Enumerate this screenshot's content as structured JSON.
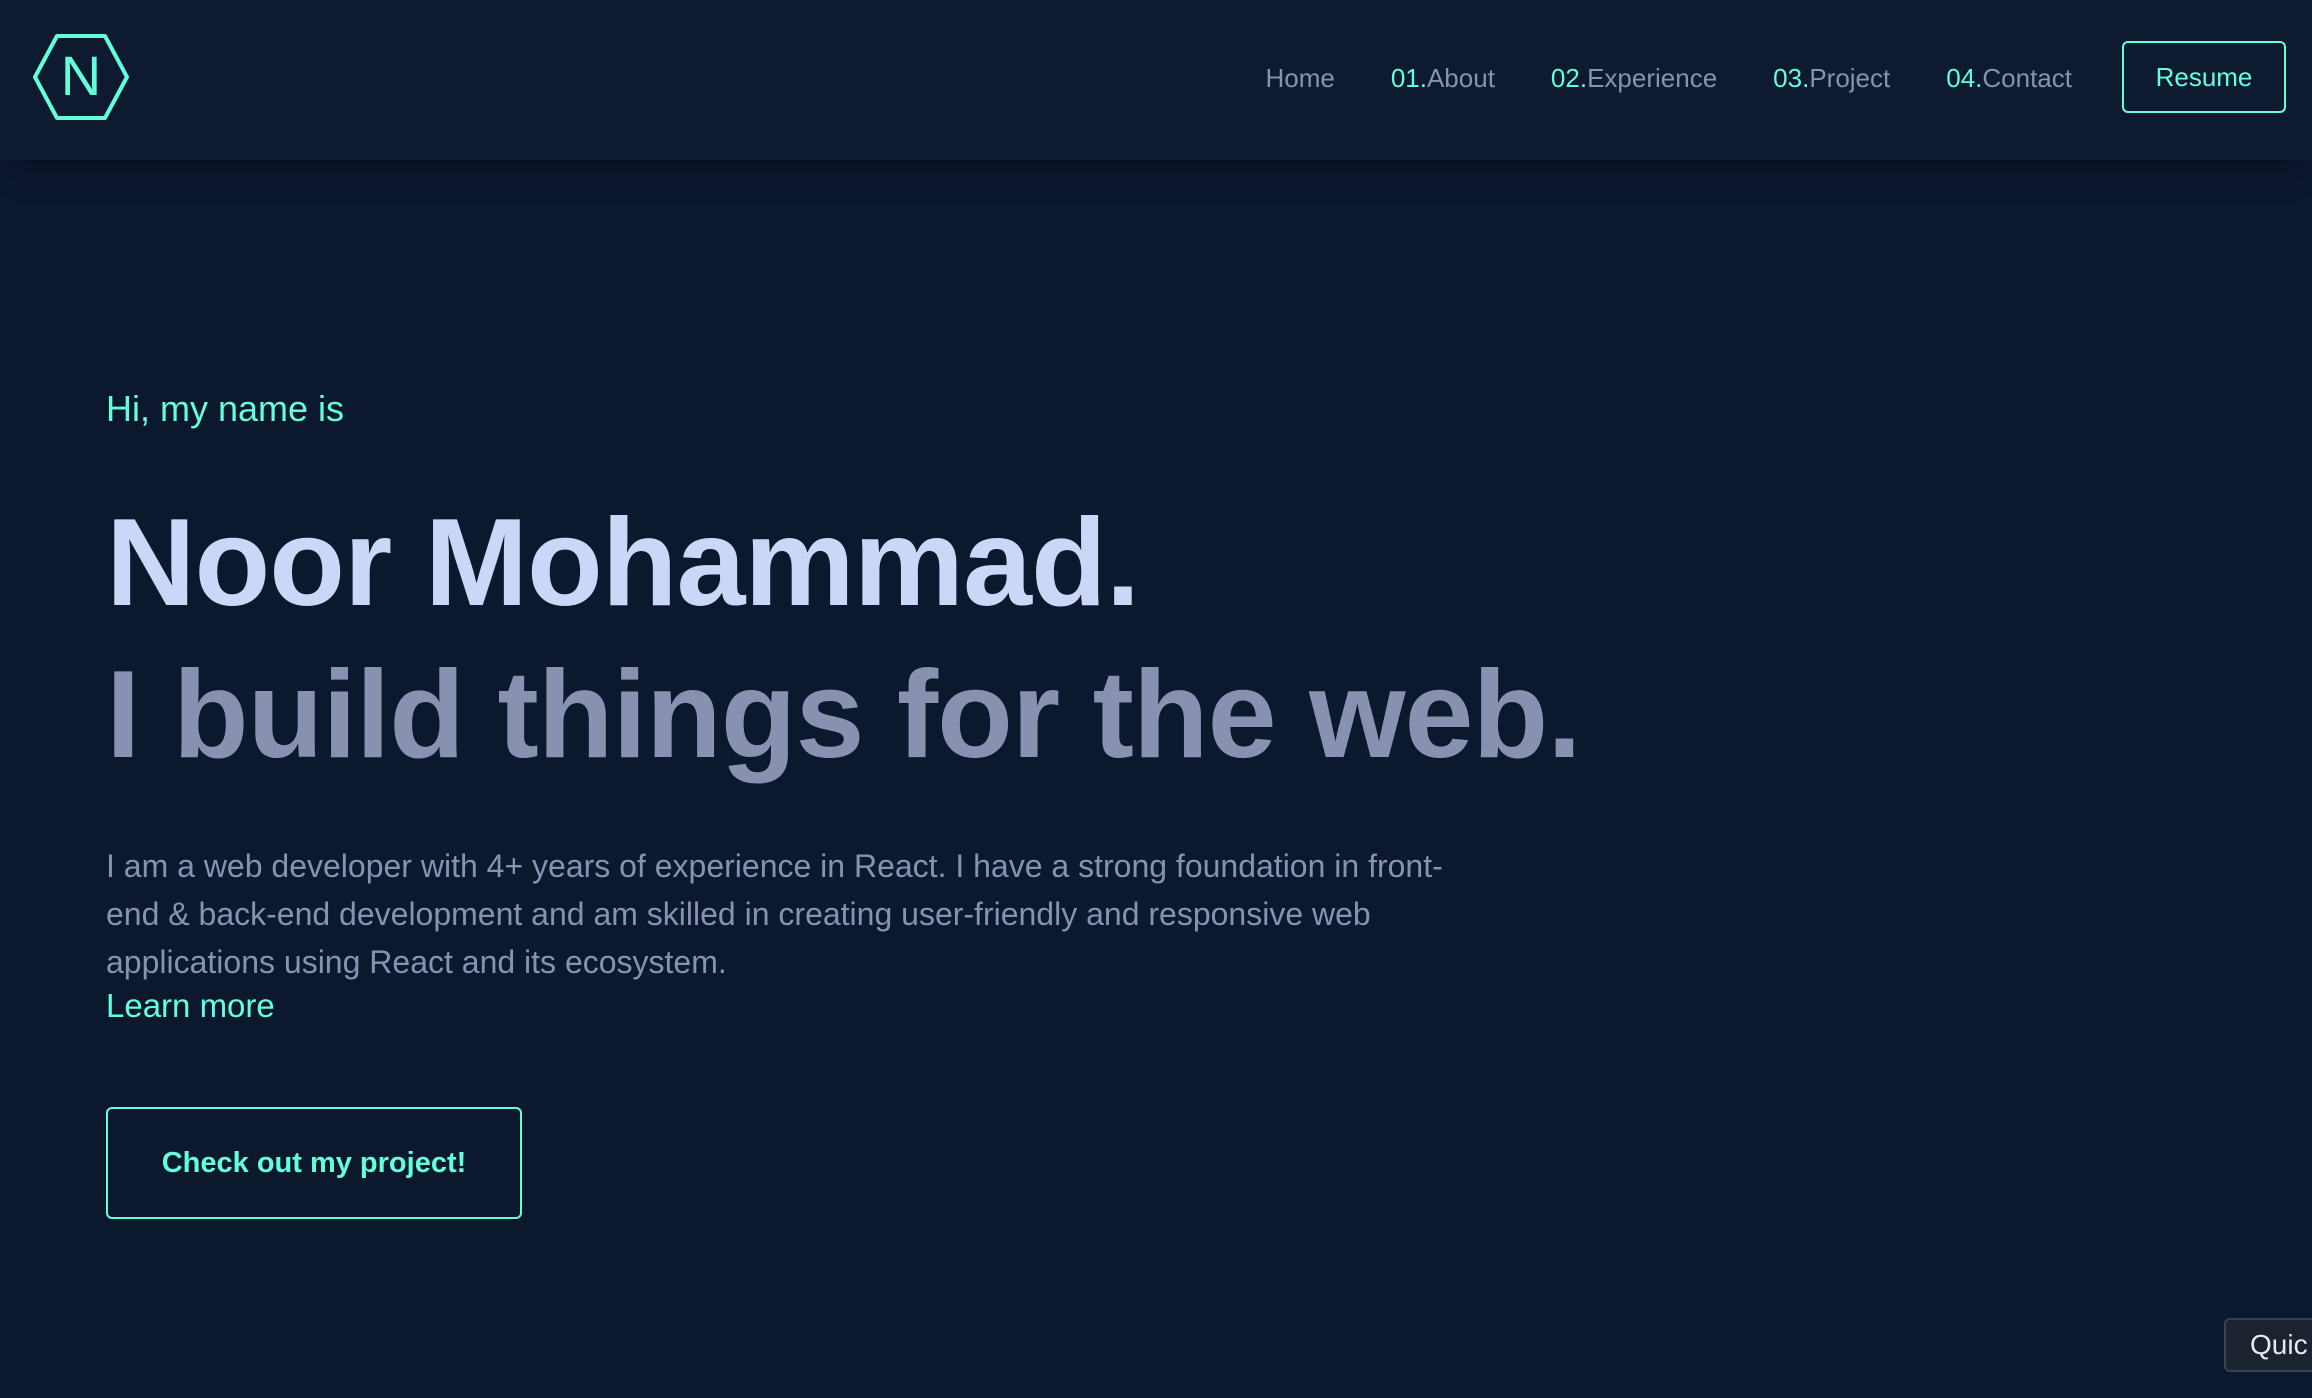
{
  "colors": {
    "background": "#0c182e",
    "header_background": "#0d1a30",
    "accent": "#64ffda",
    "heading": "#ccd6f6",
    "muted": "#8892b0"
  },
  "logo": {
    "letter": "N",
    "icon": "hexagon-logo-icon"
  },
  "nav": {
    "items": [
      {
        "number": "",
        "label": "Home"
      },
      {
        "number": "01.",
        "label": "About"
      },
      {
        "number": "02.",
        "label": "Experience"
      },
      {
        "number": "03.",
        "label": "Project"
      },
      {
        "number": "04.",
        "label": "Contact"
      }
    ],
    "resume_label": "Resume"
  },
  "hero": {
    "greeting": "Hi, my name is",
    "name": "Noor Mohammad.",
    "tagline": "I build things for the web.",
    "bio": "I am a web developer with 4+ years of experience in React. I have a strong foundation in front-end & back-end development and am skilled in creating user-friendly and responsive web applications using React and its ecosystem.",
    "learn_more": "Learn more",
    "cta_label": "Check out my project!"
  },
  "widget": {
    "label": "Quic"
  }
}
